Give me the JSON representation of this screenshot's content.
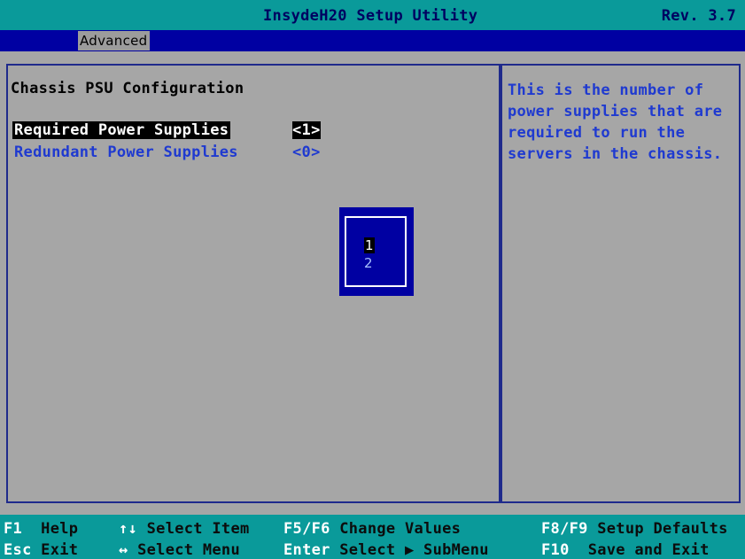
{
  "app": {
    "title": "InsydeH20 Setup Utility",
    "revision": "Rev. 3.7"
  },
  "menu": {
    "active_tab": "Advanced"
  },
  "page": {
    "section_title": "Chassis PSU Configuration",
    "items": [
      {
        "label": "Required Power Supplies",
        "value": "<1>",
        "selected": true
      },
      {
        "label": "Redundant Power Supplies",
        "value": "<0>",
        "selected": false
      }
    ]
  },
  "help": {
    "lines": [
      "This is the number of",
      "power supplies that are",
      "required to run the",
      "servers in the chassis."
    ]
  },
  "popup": {
    "options": [
      {
        "label": "1",
        "selected": true
      },
      {
        "label": "2",
        "selected": false
      }
    ]
  },
  "footer": {
    "row1": [
      {
        "key": "F1",
        "desc": "Help"
      },
      {
        "key": "↑↓",
        "desc": "Select Item"
      },
      {
        "key": "F5/F6",
        "desc": "Change Values"
      },
      {
        "key": "F8/F9",
        "desc": "Setup Defaults"
      }
    ],
    "row2": [
      {
        "key": "Esc",
        "desc": "Exit"
      },
      {
        "key": "↔",
        "desc": "Select Menu"
      },
      {
        "key": "Enter",
        "desc": "Select ▶ SubMenu"
      },
      {
        "key": "F10",
        "desc": "Save and Exit"
      }
    ]
  },
  "colors": {
    "teal": "#0a9a9a",
    "menubar_blue": "#0000a2",
    "panel_gray": "#a6a6a6",
    "frame_blue": "#1f2a8c",
    "item_blue": "#1f3ad0"
  }
}
